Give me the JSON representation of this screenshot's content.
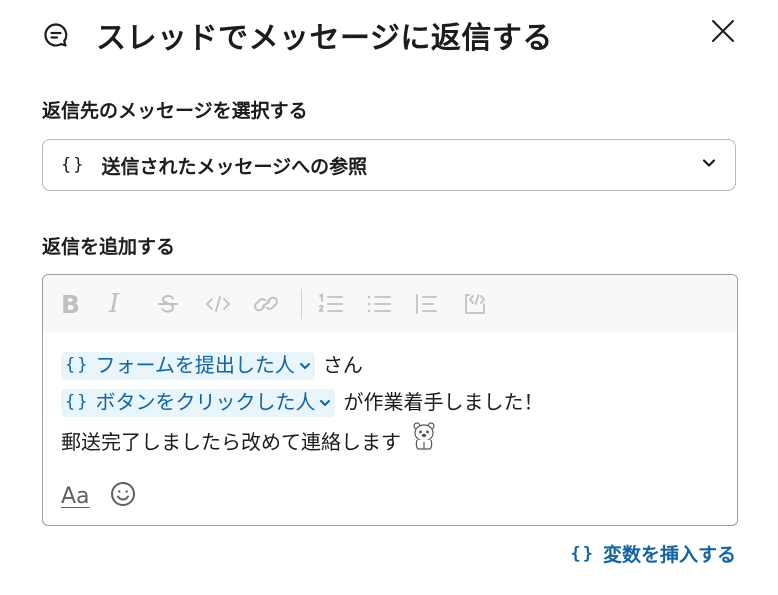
{
  "dialog": {
    "title": "スレッドでメッセージに返信する",
    "close_icon": "close-icon",
    "title_icon": "message-reply-icon"
  },
  "reply_target": {
    "label": "返信先のメッセージを選択する",
    "selected_value": "送信されたメッセージへの参照",
    "brace": "{}"
  },
  "reply": {
    "label": "返信を追加する",
    "toolbar": [
      "bold-icon",
      "italic-icon",
      "strikethrough-icon",
      "code-icon",
      "link-icon",
      "ordered-list-icon",
      "bulleted-list-icon",
      "blockquote-icon",
      "code-block-icon"
    ],
    "toolbar_text": {
      "bold": "B",
      "italic": "I"
    },
    "lines": [
      {
        "chip": "フォームを提出した人",
        "text": "さん"
      },
      {
        "chip": "ボタンをクリックした人",
        "text": "が作業着手しました！"
      },
      {
        "text": "郵送完了しましたら改めて連絡します"
      }
    ],
    "brace": "{}",
    "format_label": "Aa"
  },
  "insert_variable": {
    "brace": "{}",
    "label": "変数を挿入する"
  },
  "colors": {
    "accent": "#1264a3",
    "chip_bg": "#e8f5fa",
    "text": "#1d1c1d"
  }
}
